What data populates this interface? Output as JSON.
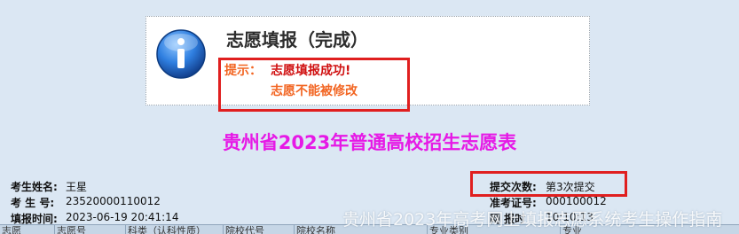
{
  "notice": {
    "title": "志愿填报（完成）",
    "hint_label": "提示：",
    "hint_line1": "志愿填报成功!",
    "hint_line2": "志愿不能被修改",
    "icon": "info-icon"
  },
  "form_title": "贵州省2023年普通高校招生志愿表",
  "student": {
    "name_label": "考生姓名:",
    "name_value": "王星",
    "id_label": "考 生 号:",
    "id_value": "23520000110012",
    "time_label": "填报时间:",
    "time_value": "2023-06-19 20:41:14"
  },
  "submission": {
    "count_label": "提交次数:",
    "count_value": "第3次提交",
    "ticket_label": "准考证号:",
    "ticket_value": "000100012",
    "partial_label": "网   报时",
    "partial_value": "10:10:13"
  },
  "table_headers": [
    "志愿",
    "志愿号",
    "科类（认科性质）",
    "院校代号",
    "院校名称",
    "专业类别",
    "专业"
  ],
  "watermark": "贵州省2023年高考网上填报志愿系统考生操作指南"
}
